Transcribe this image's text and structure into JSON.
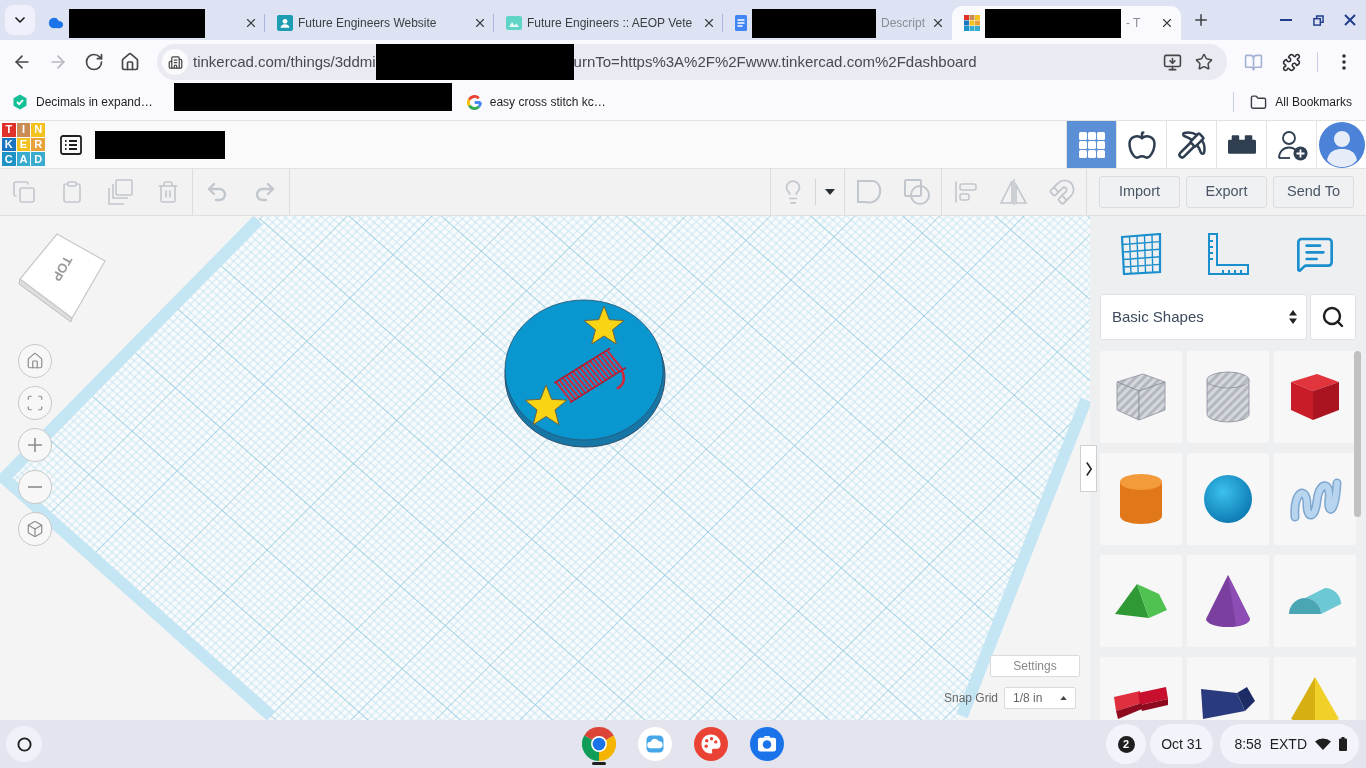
{
  "browser": {
    "tabs": [
      {
        "kind": "cloud",
        "redacted": true,
        "selected": false
      },
      {
        "kind": "person-card",
        "title": "Future Engineers Website",
        "redacted": false,
        "selected": false
      },
      {
        "kind": "image",
        "title": "Future Engineers :: AEOP Vete",
        "redacted": false,
        "selected": false
      },
      {
        "kind": "document",
        "title": "Descript",
        "redacted": true,
        "selected": false
      },
      {
        "kind": "logo",
        "title": "- T",
        "redacted": true,
        "selected": true
      }
    ],
    "nav": [
      {
        "kind": "back",
        "disabled": false
      },
      {
        "kind": "forward",
        "disabled": true
      },
      {
        "kind": "reload",
        "disabled": false
      },
      {
        "kind": "home",
        "disabled": false
      }
    ],
    "address": {
      "before_redaction": "tinkercad.com/things/3ddmi",
      "after_redaction": "urnTo=https%3A%2F%2Fwww.tinkercad.com%2Fdashboard"
    },
    "bookmarks": [
      {
        "kind": "hexagon",
        "label": "Decimals in expand…"
      },
      {
        "kind": "redacted"
      },
      {
        "kind": "google",
        "label": "easy cross stitch kc…"
      }
    ],
    "all_bookmarks": "All Bookmarks"
  },
  "header": {
    "logo": [
      {
        "letter": "T",
        "color": "#e0302a"
      },
      {
        "letter": "I",
        "color": "#c98c55"
      },
      {
        "letter": "N",
        "color": "#f4c21f"
      },
      {
        "letter": "K",
        "color": "#1b74bf"
      },
      {
        "letter": "E",
        "color": "#f4c21f"
      },
      {
        "letter": "R",
        "color": "#e7a33a"
      },
      {
        "letter": "C",
        "color": "#1c93c4"
      },
      {
        "letter": "A",
        "color": "#3aaccf"
      },
      {
        "letter": "D",
        "color": "#3aaccf"
      }
    ],
    "tools": [
      {
        "kind": "grid",
        "selected": true
      },
      {
        "kind": "apple",
        "selected": false
      },
      {
        "kind": "pickaxe",
        "selected": false
      },
      {
        "kind": "brick",
        "selected": false
      },
      {
        "kind": "add-user",
        "selected": false
      }
    ]
  },
  "toolbar": {
    "left_groups": [
      [
        {
          "kind": "copy",
          "disabled": true
        },
        {
          "kind": "paste",
          "disabled": true
        },
        {
          "kind": "duplicate",
          "disabled": true
        },
        {
          "kind": "delete",
          "disabled": true
        }
      ],
      [
        {
          "kind": "undo",
          "disabled": true
        },
        {
          "kind": "redo",
          "disabled": true
        }
      ]
    ],
    "right_groups": [
      [
        {
          "kind": "bulb",
          "disabled": true
        },
        {
          "kind": "caret",
          "disabled": false
        }
      ],
      [
        {
          "kind": "group",
          "disabled": true
        },
        {
          "kind": "ungroup",
          "disabled": true
        }
      ],
      [
        {
          "kind": "align",
          "disabled": true
        },
        {
          "kind": "mirror",
          "disabled": true
        },
        {
          "kind": "magnet",
          "disabled": true
        }
      ]
    ],
    "actions": [
      "Import",
      "Export",
      "Send To"
    ]
  },
  "canvas": {
    "view_cube": "TOP",
    "view_controls": [
      {
        "kind": "home"
      },
      {
        "kind": "fit"
      },
      {
        "kind": "zoom-in"
      },
      {
        "kind": "zoom-out"
      },
      {
        "kind": "perspective"
      }
    ],
    "settings": "Settings",
    "snap_grid": {
      "label": "Snap Grid",
      "value": "1/8 in"
    }
  },
  "panel": {
    "tools": [
      {
        "kind": "workplane"
      },
      {
        "kind": "ruler"
      },
      {
        "kind": "notes"
      }
    ],
    "library": "Basic Shapes",
    "shapes": [
      {
        "kind": "box",
        "hole": true
      },
      {
        "kind": "cylinder",
        "hole": true
      },
      {
        "kind": "box",
        "hole": false
      },
      {
        "kind": "cylinder",
        "hole": false
      },
      {
        "kind": "sphere",
        "hole": false
      },
      {
        "kind": "scribble",
        "hole": false
      },
      {
        "kind": "roof",
        "hole": false
      },
      {
        "kind": "cone",
        "hole": false
      },
      {
        "kind": "round-roof",
        "hole": false
      },
      {
        "kind": "text",
        "hole": false
      },
      {
        "kind": "wedge",
        "hole": false
      },
      {
        "kind": "pyramid",
        "hole": false
      }
    ]
  },
  "taskbar": {
    "apps": [
      {
        "kind": "browser",
        "running": true
      },
      {
        "kind": "cloud",
        "running": false
      },
      {
        "kind": "palette",
        "running": false
      },
      {
        "kind": "camera",
        "running": false
      }
    ],
    "notifications": "2",
    "date": "Oct 31",
    "time": "8:58",
    "mode": "EXTD"
  }
}
